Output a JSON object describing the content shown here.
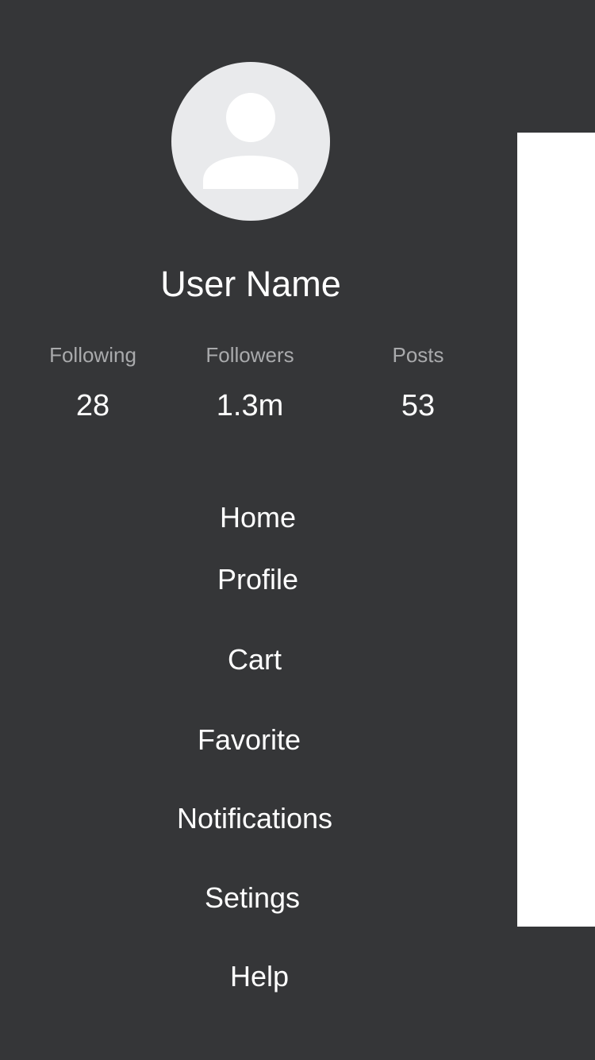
{
  "profile": {
    "avatar_icon": "user-silhouette-icon",
    "user_name": "User Name"
  },
  "stats": {
    "following": {
      "label": "Following",
      "value": "28"
    },
    "followers": {
      "label": "Followers",
      "value": "1.3m"
    },
    "posts": {
      "label": "Posts",
      "value": "53"
    }
  },
  "menu": {
    "items": [
      {
        "label": "Home"
      },
      {
        "label": "Profile"
      },
      {
        "label": "Cart"
      },
      {
        "label": "Favorite"
      },
      {
        "label": "Notifications"
      },
      {
        "label": "Setings"
      },
      {
        "label": "Help"
      }
    ]
  },
  "colors": {
    "background": "#353638",
    "avatar_bg": "#e9eaec",
    "text_primary": "#ffffff",
    "text_secondary": "#a9aaac",
    "content_panel": "#ffffff"
  }
}
